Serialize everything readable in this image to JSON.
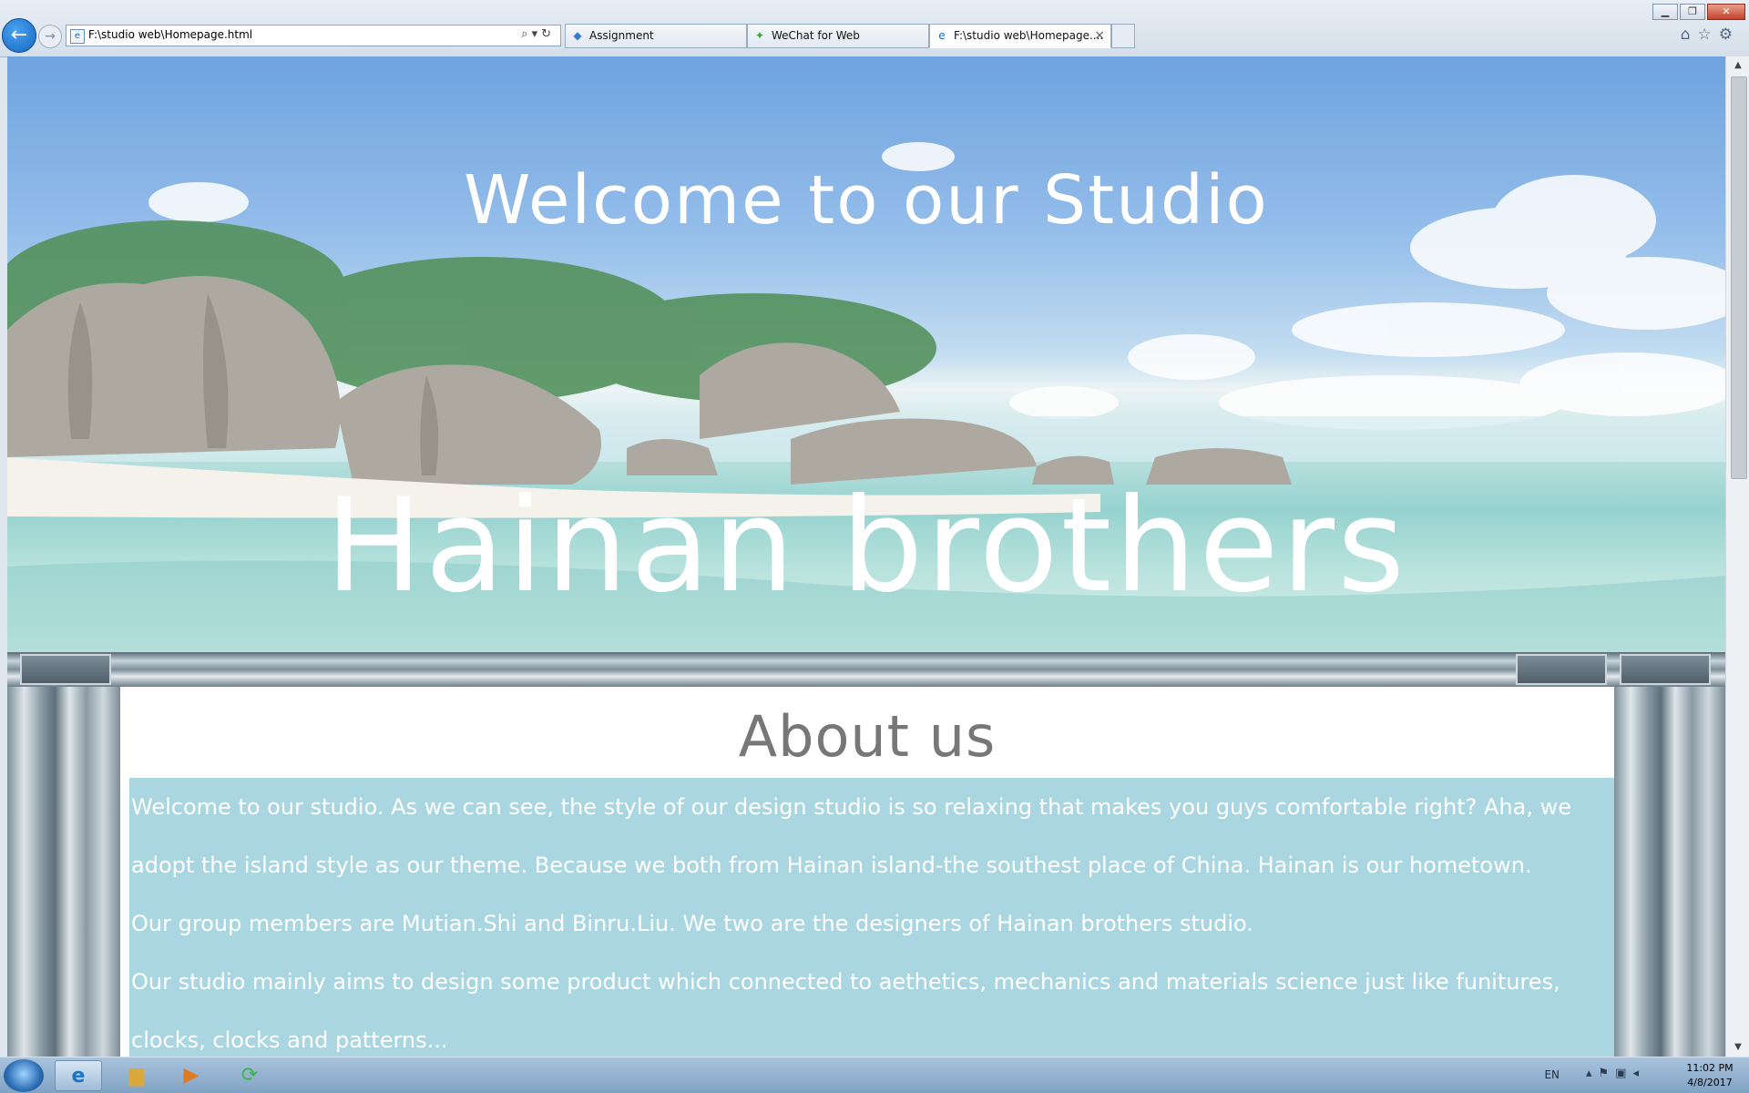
{
  "window": {
    "controls": [
      "▁",
      "❐",
      "✕"
    ]
  },
  "toolbar": {
    "back_glyph": "←",
    "forward_glyph": "→",
    "address": "F:\\studio web\\Homepage.html",
    "address_tools": "⌕▾↻",
    "right_icons": "⌂☆⚙"
  },
  "tabs": [
    {
      "label": "Assignment",
      "icon": "cube-icon",
      "active": false
    },
    {
      "label": "WeChat for Web",
      "icon": "wechat-icon",
      "active": false
    },
    {
      "label": "F:\\studio web\\Homepage....",
      "icon": "ie-page-icon",
      "active": true
    }
  ],
  "hero": {
    "welcome": "Welcome to our Studio",
    "brand": "Hainan brothers"
  },
  "about": {
    "title": "About us",
    "paragraph_1_line_1": "Welcome to our studio. As we can see, the style of our design studio is so relaxing that makes you guys comfortable right? Aha, we",
    "paragraph_1_line_2": "adopt the island style as our theme. Because we both from Hainan island-the southest place of China. Hainan is our hometown.",
    "paragraph_2": "Our group members are Mutian.Shi and Binru.Liu. We two are the designers of Hainan brothers studio.",
    "paragraph_3_line_1": "Our studio mainly aims to design some product which connected to aethetics, mechanics and materials science just like funitures,",
    "paragraph_3_line_2": "clocks, clocks and patterns..."
  },
  "taskbar": {
    "items": [
      "internet-explorer-icon",
      "file-explorer-icon",
      "media-player-icon",
      "refresh-app-icon"
    ],
    "language": "EN",
    "time": "11:02 PM",
    "date": "4/8/2017"
  },
  "colors": {
    "about_box": "#aad6e2",
    "about_title": "#777777",
    "text_on_box": "#ffffff"
  }
}
